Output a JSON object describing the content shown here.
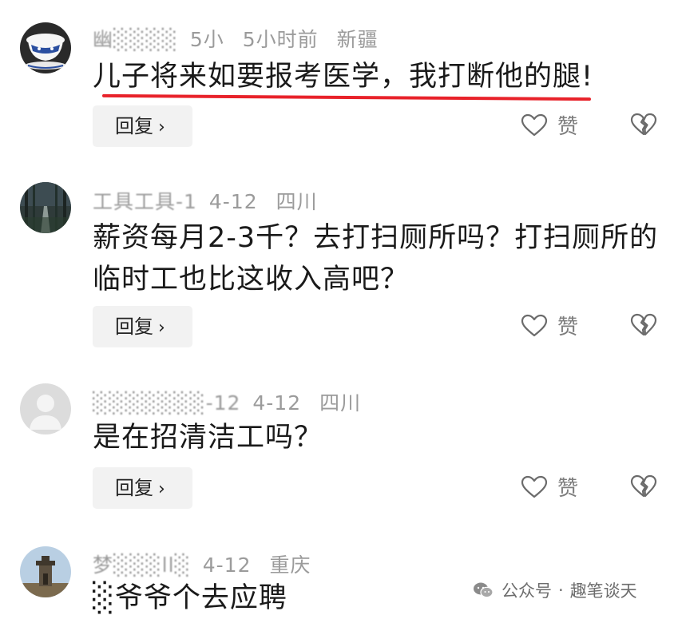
{
  "comments": [
    {
      "user": "幽░░░░",
      "time_prefix": "5小",
      "time": "5小时前",
      "location": "新疆",
      "text": "儿子将来如要报考医学，我打断他的腿!",
      "avatar": "porcelain-teacup"
    },
    {
      "user": "工具工具-1",
      "time": "4-12",
      "location": "四川",
      "text": "薪资每月2-3千？去打扫厕所吗？打扫厕所的临时工也比这收入高吧？",
      "avatar": "forest-road"
    },
    {
      "user": "░░░░░░░-12",
      "time": "4-12",
      "location": "四川",
      "text": "是在招清洁工吗？",
      "avatar": "default-gray"
    },
    {
      "user": "梦░░░ll░",
      "time": "4-12",
      "location": "重庆",
      "text": "░爷爷个去应聘",
      "avatar": "stone-tower"
    }
  ],
  "actions": {
    "reply_label": "回复",
    "reply_chevron": "›",
    "like_label": "赞"
  },
  "watermark": {
    "source": "公众号",
    "separator": "·",
    "account": "趣笔谈天"
  },
  "colors": {
    "highlight_underline": "#e8222a",
    "meta_text": "#9b9b9b",
    "reply_bg": "#f2f2f2"
  }
}
